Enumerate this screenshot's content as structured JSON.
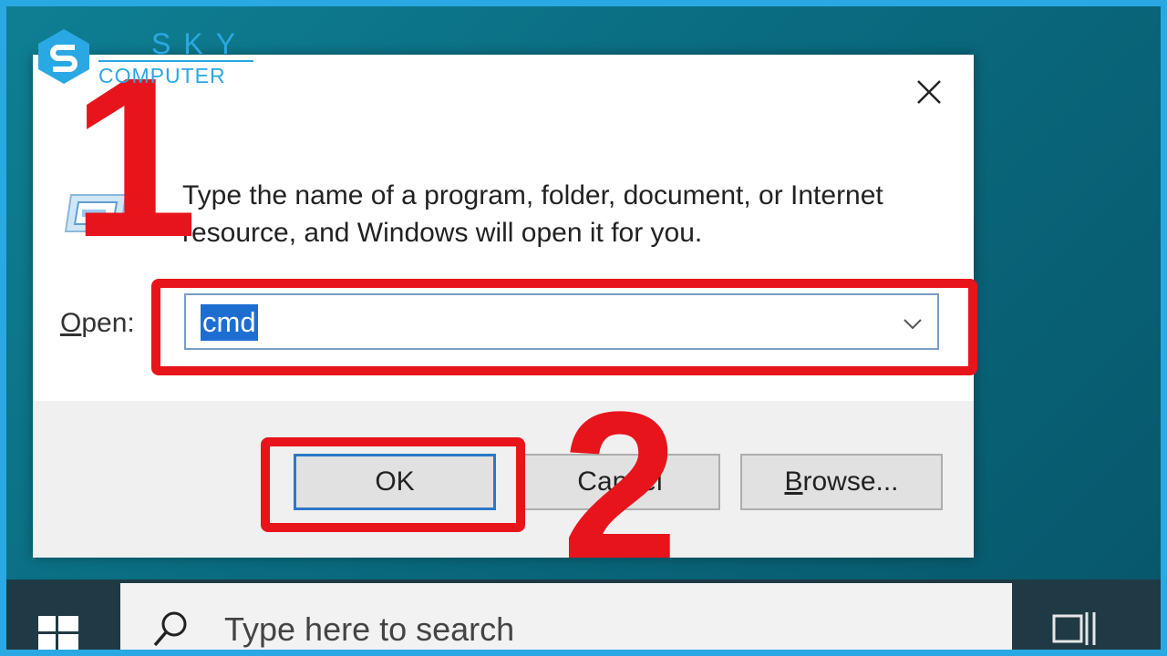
{
  "watermark": {
    "brand_top": "SKY",
    "brand_bottom": "COMPUTER"
  },
  "dialog": {
    "description": "Type the name of a program, folder, document, or Internet resource, and Windows will open it for you.",
    "open_label_prefix": "",
    "open_label_access": "O",
    "open_label_rest": "pen:",
    "open_value": "cmd",
    "buttons": {
      "ok": "OK",
      "cancel": "Cancel",
      "browse_access": "B",
      "browse_rest": "rowse..."
    }
  },
  "annotations": {
    "step1": "1",
    "step2": "2",
    "highlight_color": "#e8141c"
  },
  "taskbar": {
    "search_placeholder": "Type here to search"
  },
  "icons": [
    "close-icon",
    "run-icon",
    "chevron-down-icon",
    "windows-start-icon",
    "search-icon",
    "task-view-icon",
    "sky-logo-icon"
  ]
}
